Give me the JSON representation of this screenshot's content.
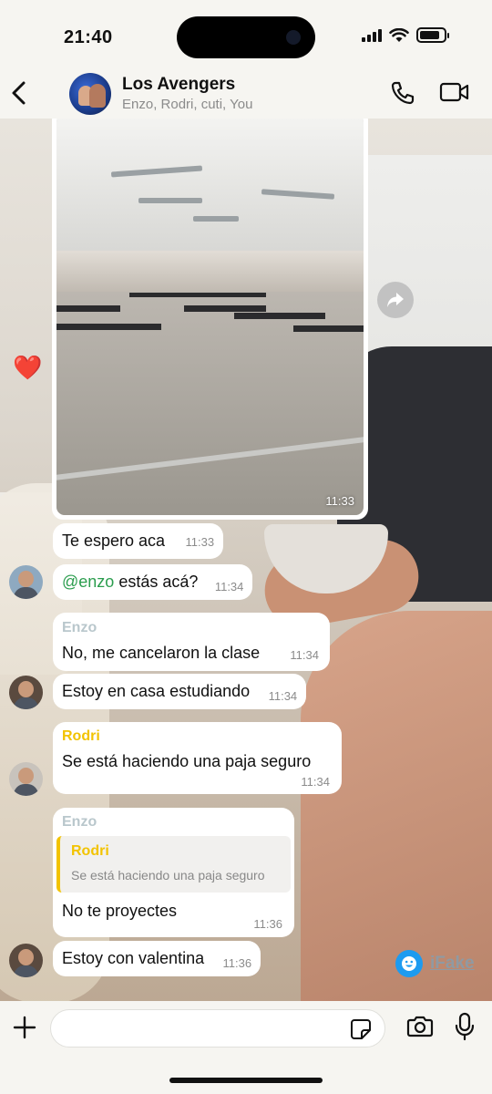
{
  "status_bar": {
    "time": "21:40"
  },
  "header": {
    "title": "Los Avengers",
    "members": "Enzo, Rodri, cuti, You"
  },
  "photo_message": {
    "time": "11:33"
  },
  "reaction": "❤️",
  "messages": [
    {
      "text": "Te espero aca",
      "time": "11:33"
    },
    {
      "mention": "@enzo",
      "text": " estás acá?",
      "time": "11:34"
    },
    {
      "sender": "Enzo",
      "sender_color": "#b9c7cc",
      "text": "No, me cancelaron la clase",
      "time": "11:34"
    },
    {
      "text": "Estoy en casa estudiando",
      "time": "11:34"
    },
    {
      "sender": "Rodri",
      "sender_color": "#f2c300",
      "text": "Se está haciendo una paja seguro",
      "time": "11:34"
    },
    {
      "sender": "Enzo",
      "sender_color": "#b9c7cc",
      "quote": {
        "sender": "Rodri",
        "text": "Se está haciendo una paja seguro"
      },
      "text": "No te proyectes",
      "time": "11:36"
    },
    {
      "text": "Estoy con valentina",
      "time": "11:36"
    }
  ],
  "watermark": {
    "text": "iFake"
  },
  "input": {
    "placeholder": ""
  },
  "colors": {
    "mention": "#2b9d4e",
    "quote_accent": "#f2c300",
    "watermark_icon": "#1d9bf0"
  },
  "icons": [
    "back-arrow-icon",
    "phone-icon",
    "video-camera-icon",
    "forward-icon",
    "plus-icon",
    "sticker-icon",
    "camera-icon",
    "microphone-icon"
  ]
}
